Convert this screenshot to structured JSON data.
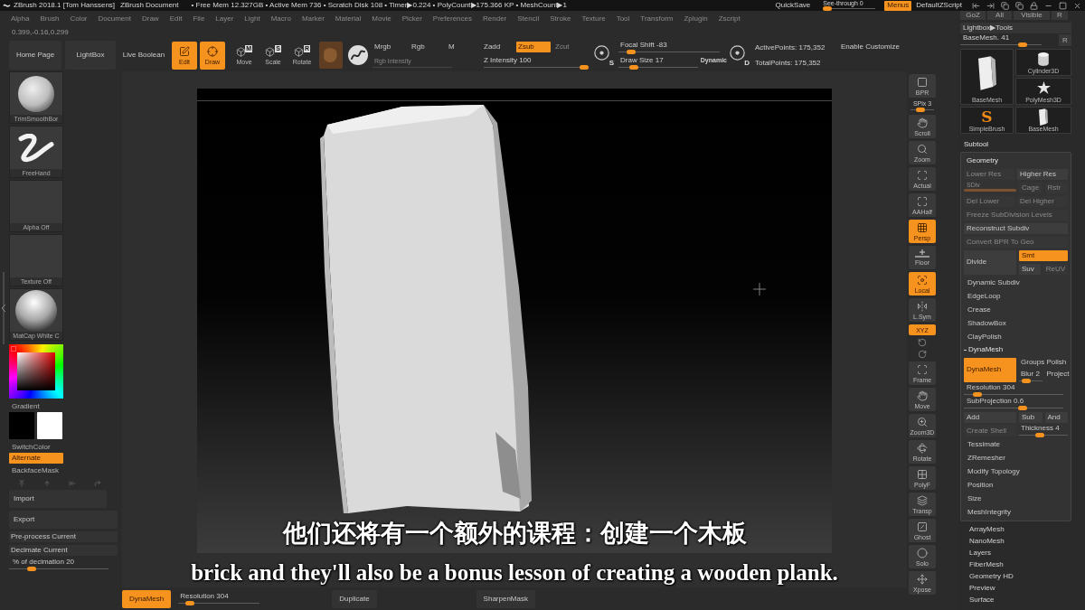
{
  "title_bar": {
    "app": "ZBrush 2018.1 [Tom Hanssens]",
    "document": "ZBrush Document",
    "status": "• Free Mem 12.327GB • Active Mem 736 • Scratch Disk 108 • Timer▶0.224 • PolyCount▶175.366 KP • MeshCount▶1",
    "quicksave": "QuickSave",
    "see_through": {
      "label": "See-through 0",
      "level": 0
    },
    "menus": {
      "label": "Menus",
      "on": true
    },
    "script": "DefaultZScript"
  },
  "menu_bar": [
    "Alpha",
    "Brush",
    "Color",
    "Document",
    "Draw",
    "Edit",
    "File",
    "Layer",
    "Light",
    "Macro",
    "Marker",
    "Material",
    "Movie",
    "Picker",
    "Preferences",
    "Render",
    "Stencil",
    "Stroke",
    "Texture",
    "Tool",
    "Transform",
    "Zplugin",
    "Zscript"
  ],
  "coordinates": "0.399,-0.16,0.299",
  "shelf": {
    "buttons": [
      "Home Page",
      "LightBox"
    ],
    "live_boolean": "Live Boolean",
    "modes": [
      {
        "kind": "edit",
        "label": "Edit",
        "on": true
      },
      {
        "kind": "draw",
        "label": "Draw",
        "on": true
      },
      {
        "kind": "transform",
        "label": "Move",
        "badge": "M",
        "on": false
      },
      {
        "kind": "transform",
        "label": "Scale",
        "badge": "S",
        "on": false
      },
      {
        "kind": "transform",
        "label": "Rotate",
        "badge": "R",
        "on": false
      }
    ],
    "channels": [
      {
        "label": "Mrgb",
        "on": false,
        "disabled": false
      },
      {
        "label": "Rgb",
        "on": false,
        "disabled": false
      },
      {
        "label": "M",
        "on": false,
        "disabled": false
      },
      {
        "label": "Zadd",
        "on": false,
        "disabled": false
      },
      {
        "label": "Zsub",
        "on": true,
        "disabled": false
      },
      {
        "label": "Zcut",
        "on": false,
        "disabled": true
      }
    ],
    "rgb_intensity": {
      "label": "Rgb Intensity",
      "disabled": true
    },
    "z_intensity": {
      "label": "Z Intensity 100",
      "level": 1
    },
    "focal_glyph": "S",
    "focal_shift": {
      "label": "Focal Shift -83",
      "level": 0.085
    },
    "draw_size": {
      "label": "Draw Size 17",
      "level": 0.15
    },
    "dynamic": "Dynamic",
    "size_glyph": "D",
    "active_points": "ActivePoints: 175,352",
    "total_points": "TotalPoints: 175,352",
    "customize": "Enable Customize"
  },
  "left_panel": {
    "tiles": [
      {
        "kind": "sphere",
        "label": "TrimSmoothBor"
      },
      {
        "kind": "stroke",
        "label": "FreeHand"
      },
      {
        "kind": "empty",
        "label": "Alpha Off"
      },
      {
        "kind": "empty",
        "label": "Texture Off"
      },
      {
        "kind": "matcap",
        "label": "MatCap White C"
      }
    ],
    "gradient": "Gradient",
    "swatches": [
      {
        "color": "#000000"
      },
      {
        "color": "#ffffff"
      }
    ],
    "switch_color": "SwitchColor",
    "alternate": {
      "label": "Alternate",
      "on": true
    },
    "backface_mask": "BackfaceMask",
    "buttons": [
      "Import",
      "Export"
    ],
    "actions": [
      "Pre-process Current",
      "Decimate Current"
    ],
    "decimation": {
      "label": "% of decimation 20",
      "level": 0.2
    }
  },
  "subtitles": {
    "chinese": "他们还将有一个额外的课程：创建一个木板",
    "english": "brick and they'll also be a bonus lesson of creating a wooden plank."
  },
  "bottom_shelf": [
    {
      "kind": "button",
      "label": "DynaMesh",
      "on": true
    },
    {
      "kind": "slider",
      "label": "Resolution 304",
      "level": 0.1
    },
    {
      "kind": "button",
      "label": "Duplicate",
      "on": false
    },
    {
      "kind": "button",
      "label": "SharpenMask",
      "on": false
    }
  ],
  "right_shelf": [
    {
      "kind": "button",
      "label": "BPR",
      "on": false
    },
    {
      "kind": "slider",
      "label": "SPix 3",
      "level": 0.4
    },
    {
      "kind": "button",
      "label": "Scroll",
      "on": false
    },
    {
      "kind": "button",
      "label": "Zoom",
      "on": false
    },
    {
      "kind": "button",
      "label": "Actual",
      "on": false
    },
    {
      "kind": "button",
      "label": "AAHalf",
      "on": false
    },
    {
      "kind": "button",
      "label": "Persp",
      "on": true
    },
    {
      "kind": "button",
      "label": "Floor",
      "on": false
    },
    {
      "kind": "button",
      "label": "Local",
      "on": true
    },
    {
      "kind": "button",
      "label": "L.Sym",
      "on": false
    },
    {
      "kind": "small",
      "label": "XYZ",
      "on": true
    },
    {
      "kind": "icons"
    },
    {
      "kind": "button",
      "label": "Frame",
      "on": false
    },
    {
      "kind": "button",
      "label": "Move",
      "on": false
    },
    {
      "kind": "button",
      "label": "Zoom3D",
      "on": false
    },
    {
      "kind": "button",
      "label": "Rotate",
      "on": false
    },
    {
      "kind": "button",
      "label": "PolyF",
      "on": false
    },
    {
      "kind": "button",
      "label": "Transp",
      "on": false
    },
    {
      "kind": "button",
      "label": "Ghost",
      "on": false
    },
    {
      "kind": "button",
      "label": "Solo",
      "on": false
    },
    {
      "kind": "button",
      "label": "Xpose",
      "on": false
    }
  ],
  "right_panel": {
    "top_row": [
      "GoZ",
      "All",
      "Visible",
      "R"
    ],
    "lightbox": "Lightbox▶Tools",
    "current_tool": {
      "label": "BaseMesh. 41",
      "level": 0.8
    },
    "current_tool_r": "R",
    "tools": [
      {
        "kind": "box",
        "label": "BaseMesh"
      },
      {
        "kind": "brush",
        "label": "SimpleBrush",
        "glyph": "S"
      },
      {
        "kind": "cylinder",
        "label": "Cylinder3D"
      },
      {
        "kind": "star",
        "label": "PolyMesh3D"
      },
      {
        "kind": "box",
        "label": "BaseMesh"
      }
    ],
    "subtool": "Subtool",
    "geometry": {
      "title": "Geometry",
      "rows": [
        {
          "kind": "pair",
          "items": [
            {
              "label": "Lower Res",
              "disabled": true
            },
            {
              "label": "Higher Res",
              "disabled": false
            }
          ]
        },
        {
          "kind": "sdiv",
          "slider": {
            "label": "SDiv",
            "disabled": true,
            "level": 1
          },
          "items": [
            {
              "label": "Cage",
              "disabled": true
            },
            {
              "label": "Rstr",
              "disabled": true
            }
          ]
        },
        {
          "kind": "pair",
          "items": [
            {
              "label": "Del Lower",
              "disabled": true
            },
            {
              "label": "Del Higher",
              "disabled": true
            }
          ]
        },
        {
          "kind": "wide",
          "label": "Freeze SubDivision Levels",
          "disabled": true
        },
        {
          "kind": "wide",
          "label": "Reconstruct Subdiv",
          "disabled": false
        },
        {
          "kind": "wide",
          "label": "Convert BPR To Geo",
          "disabled": true
        },
        {
          "kind": "divide",
          "button": {
            "label": "Divide",
            "on": false
          },
          "options": [
            {
              "label": "Smt",
              "on": true,
              "disabled": false
            },
            {
              "label": "Suv",
              "on": false,
              "disabled": false
            },
            {
              "label": "ReUV",
              "on": false,
              "disabled": true
            }
          ]
        },
        {
          "kind": "sub",
          "label": "Dynamic Subdiv"
        },
        {
          "kind": "sub",
          "label": "EdgeLoop"
        },
        {
          "kind": "sub",
          "label": "Crease"
        },
        {
          "kind": "sub",
          "label": "ShadowBox"
        },
        {
          "kind": "sub",
          "label": "ClayPolish"
        },
        {
          "kind": "header",
          "label": "DynaMesh",
          "expanded": true
        },
        {
          "kind": "dynamesh",
          "button": {
            "label": "DynaMesh",
            "on": true
          },
          "options": [
            {
              "label": "Groups",
              "on": false
            },
            {
              "label": "Polish",
              "on": false
            },
            {
              "label": "Blur 2",
              "on": false,
              "level": 0.2
            },
            {
              "label": "Project",
              "on": false
            }
          ]
        },
        {
          "kind": "slider",
          "label": "Resolution 304",
          "level": 0.1
        },
        {
          "kind": "slider",
          "label": "SubProjection 0.6",
          "level": 0.6
        },
        {
          "kind": "triple",
          "items": [
            {
              "label": "Add",
              "on": false
            },
            {
              "label": "Sub",
              "on": false
            },
            {
              "label": "And",
              "on": false
            }
          ]
        },
        {
          "kind": "shell",
          "button": {
            "label": "Create Shell",
            "disabled": true
          },
          "slider": {
            "label": "Thickness 4",
            "level": 0.4
          }
        },
        {
          "kind": "sub",
          "label": "Tessimate"
        },
        {
          "kind": "sub",
          "label": "ZRemesher"
        },
        {
          "kind": "sub",
          "label": "Modify Topology"
        },
        {
          "kind": "sub",
          "label": "Position"
        },
        {
          "kind": "sub",
          "label": "Size"
        },
        {
          "kind": "sub",
          "label": "MeshIntegrity"
        }
      ]
    },
    "sections": [
      "ArrayMesh",
      "NanoMesh",
      "Layers",
      "FiberMesh",
      "Geometry HD",
      "Preview",
      "Surface"
    ]
  }
}
